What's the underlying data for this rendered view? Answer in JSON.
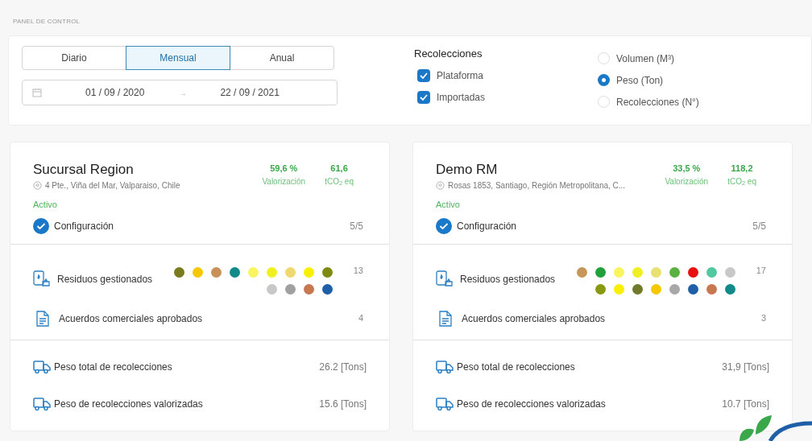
{
  "page_title": "PANEL DE CONTROL",
  "period_tabs": [
    {
      "label": "Diario",
      "selected": false
    },
    {
      "label": "Mensual",
      "selected": true
    },
    {
      "label": "Anual",
      "selected": false
    }
  ],
  "date_range": {
    "start": "01 / 09 / 2020",
    "separator": "→",
    "end": "22 / 09 / 2021"
  },
  "collections_filter": {
    "title": "Recolecciones",
    "options": [
      {
        "label": "Plataforma",
        "checked": true
      },
      {
        "label": "Importadas",
        "checked": true
      }
    ]
  },
  "measure_options": [
    {
      "label": "Volumen (M³)",
      "selected": false
    },
    {
      "label": "Peso (Ton)",
      "selected": true
    },
    {
      "label": "Recolecciones (N°)",
      "selected": false
    }
  ],
  "branches": [
    {
      "name": "Sucursal Region",
      "address": "4 Pte., Viña del Mar, Valparaiso, Chile",
      "status": "Activo",
      "active": true,
      "stats": [
        {
          "value": "59,6 %",
          "label": "Valorización"
        },
        {
          "value": "61,6",
          "label": "tCO$_{2}$ eq"
        }
      ],
      "configuration": {
        "label": "Configuración",
        "done": true,
        "value": "5/5"
      },
      "waste": {
        "label": "Residuos gestionados",
        "count": "13",
        "types": [
          {
            "color": "#7a7a1e"
          },
          {
            "color": "#f5c800"
          },
          {
            "color": "#c8915a"
          },
          {
            "color": "#138a8a"
          },
          {
            "color": "#f8f560"
          },
          {
            "color": "#f0f020"
          },
          {
            "color": "#f0d870"
          },
          {
            "color": "#f8f000"
          },
          {
            "color": "#7f8a10"
          },
          {
            "color": "#c8c8c8"
          },
          {
            "color": "#a0a0a0"
          },
          {
            "color": "#c87850"
          },
          {
            "color": "#1f5fa8"
          }
        ]
      },
      "agreements": {
        "label": "Acuerdos comerciales aprobados",
        "value": "4"
      },
      "weights": [
        {
          "label": "Peso total de recolecciones",
          "value": "26.2 [Tons]"
        },
        {
          "label": "Peso de recolecciones valorizadas",
          "value": "15.6 [Tons]"
        }
      ]
    },
    {
      "name": "Demo RM",
      "address": "Rosas 1853, Santiago, Región Metropolitana, C...",
      "status": "Activo",
      "active": true,
      "stats": [
        {
          "value": "33,5 %",
          "label": "Valorización"
        },
        {
          "value": "118,2",
          "label": "tCO$_{2}$ eq"
        }
      ],
      "configuration": {
        "label": "Configuración",
        "done": true,
        "value": "5/5"
      },
      "waste": {
        "label": "Residuos gestionados",
        "count": "17",
        "types": [
          {
            "color": "#c8955a"
          },
          {
            "color": "#22a03a"
          },
          {
            "color": "#f8f560"
          },
          {
            "color": "#f0f020"
          },
          {
            "color": "#e8e070"
          },
          {
            "color": "#5ab040"
          },
          {
            "color": "#e81010"
          },
          {
            "color": "#50c8a0"
          },
          {
            "color": "#c8c8c8"
          },
          {
            "color": "#8a9a10"
          },
          {
            "color": "#f8f000"
          },
          {
            "color": "#707a2a"
          },
          {
            "color": "#f5c800"
          },
          {
            "color": "#a8a8a8"
          },
          {
            "color": "#1f5fa8"
          },
          {
            "color": "#c87850"
          },
          {
            "color": "#138a8a"
          }
        ]
      },
      "agreements": {
        "label": "Acuerdos comerciales aprobados",
        "value": "3"
      },
      "weights": [
        {
          "label": "Peso total de recolecciones",
          "value": "31,9 [Tons]"
        },
        {
          "label": "Peso de recolecciones valorizadas",
          "value": "10.7 [Tons]"
        }
      ]
    }
  ]
}
